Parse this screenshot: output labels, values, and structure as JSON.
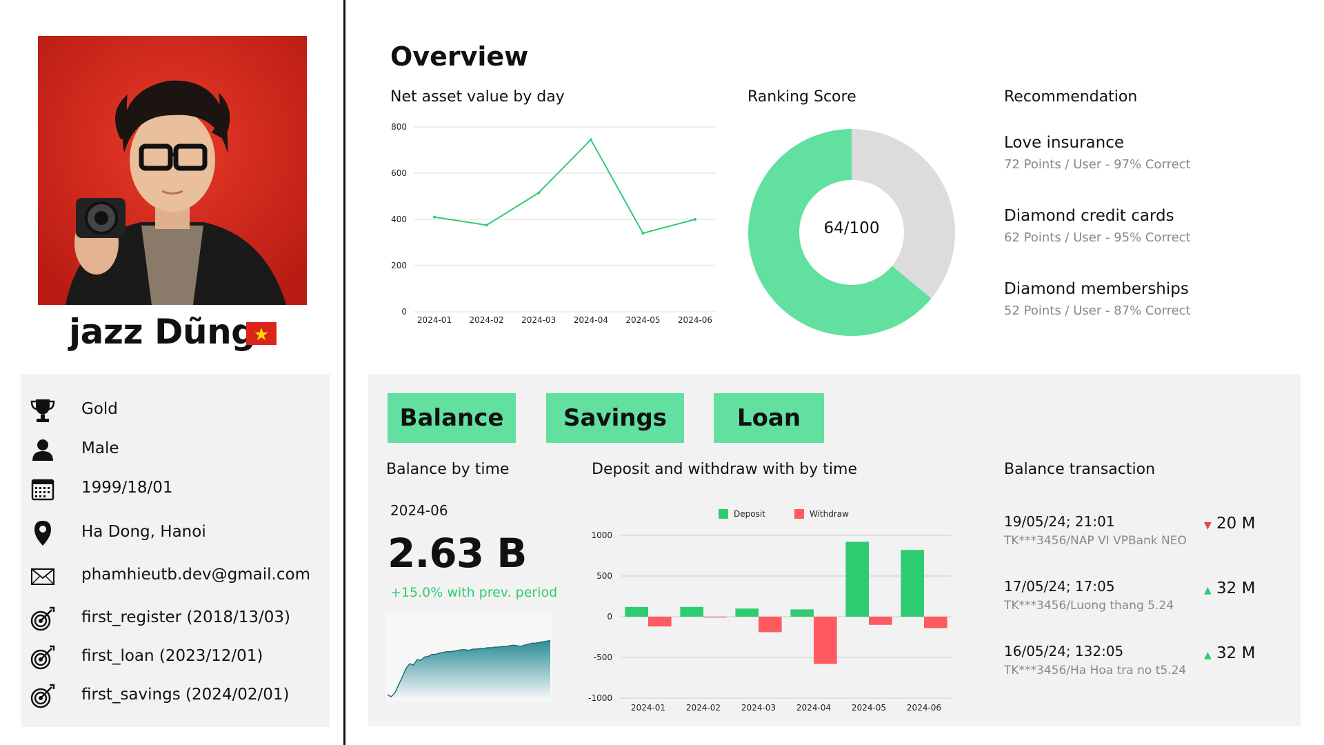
{
  "profile": {
    "name": "jazz Dũng",
    "info": [
      {
        "icon": "trophy-icon",
        "text": "Gold"
      },
      {
        "icon": "user-icon",
        "text": "Male"
      },
      {
        "icon": "calendar-icon",
        "text": "1999/18/01"
      },
      {
        "icon": "location-pin-icon",
        "text": "Ha Dong, Hanoi"
      },
      {
        "icon": "mail-icon",
        "text": "phamhieutb.dev@gmail.com"
      },
      {
        "icon": "target-icon",
        "text": "first_register (2018/13/03)"
      },
      {
        "icon": "target-icon",
        "text": "first_loan (2023/12/01)"
      },
      {
        "icon": "target-icon",
        "text": "first_savings (2024/02/01)"
      }
    ]
  },
  "overview": {
    "title": "Overview",
    "nav_title": "Net asset value by day",
    "ranking_title": "Ranking Score",
    "ranking_label": "64/100",
    "recommendation_title": "Recommendation",
    "recommendations": [
      {
        "name": "Love insurance",
        "meta": "72 Points / User - 97% Correct"
      },
      {
        "name": "Diamond credit cards",
        "meta": "62 Points / User - 95% Correct"
      },
      {
        "name": "Diamond memberships",
        "meta": "52 Points / User -  87% Correct"
      }
    ]
  },
  "bottom": {
    "tabs": [
      "Balance",
      "Savings",
      "Loan"
    ],
    "balance_title": "Balance by time",
    "balance_month": "2024-06",
    "balance_value": "2.63 B",
    "balance_change": "+15.0% with prev. period",
    "deposit_title": "Deposit and withdraw with by time",
    "transactions_title": "Balance transaction",
    "transactions": [
      {
        "date": "19/05/24; 21:01",
        "desc": "TK***3456/NAP VI VPBank NEO",
        "direction": "down",
        "amount": "20 M"
      },
      {
        "date": "17/05/24; 17:05",
        "desc": "TK***3456/Luong thang 5.24",
        "direction": "up",
        "amount": "32 M"
      },
      {
        "date": "16/05/24; 132:05",
        "desc": "TK***3456/Ha Hoa tra no  t5.24",
        "direction": "up",
        "amount": "32 M"
      }
    ]
  },
  "colors": {
    "accent_green": "#62e0a0",
    "deposit": "#2ecc71",
    "withdraw": "#ff5a5f",
    "donut_rest": "#dcdcdc",
    "sparkline": "#2a8c96",
    "down_arrow": "#e74c3c",
    "up_arrow": "#2ecc71"
  },
  "chart_data": [
    {
      "type": "line",
      "x": [
        "2024-01",
        "2024-02",
        "2024-03",
        "2024-04",
        "2024-05",
        "2024-06"
      ],
      "series": [
        {
          "values": [
            410,
            375,
            515,
            745,
            340,
            400
          ]
        }
      ],
      "ylim": [
        0,
        800
      ],
      "yticks": [
        0,
        200,
        400,
        600,
        800
      ],
      "grid": true
    },
    {
      "type": "pie",
      "values": [
        64,
        36
      ],
      "max": 100
    },
    {
      "type": "bar",
      "categories": [
        "2024-01",
        "2024-02",
        "2024-03",
        "2024-04",
        "2024-05",
        "2024-06"
      ],
      "series": [
        {
          "name": "Deposit",
          "values": [
            120,
            120,
            100,
            90,
            920,
            820
          ]
        },
        {
          "name": "Withdraw",
          "values": [
            -120,
            -10,
            -190,
            -580,
            -100,
            -140
          ]
        }
      ],
      "ylim": [
        -1000,
        1000
      ],
      "yticks": [
        -1000,
        -500,
        0,
        500,
        1000
      ],
      "legend": "top-center",
      "grid": true
    },
    {
      "type": "area",
      "values": [
        0.05,
        0.02,
        0.08,
        0.2,
        0.32,
        0.45,
        0.52,
        0.5,
        0.58,
        0.57,
        0.62,
        0.63,
        0.66,
        0.66,
        0.68,
        0.69,
        0.7,
        0.7,
        0.71,
        0.72,
        0.73,
        0.73,
        0.72,
        0.74,
        0.74,
        0.75,
        0.75,
        0.76,
        0.76,
        0.77,
        0.77,
        0.78,
        0.78,
        0.79,
        0.8,
        0.79,
        0.78,
        0.8,
        0.81,
        0.83,
        0.83,
        0.84,
        0.85,
        0.86,
        0.87
      ]
    }
  ]
}
